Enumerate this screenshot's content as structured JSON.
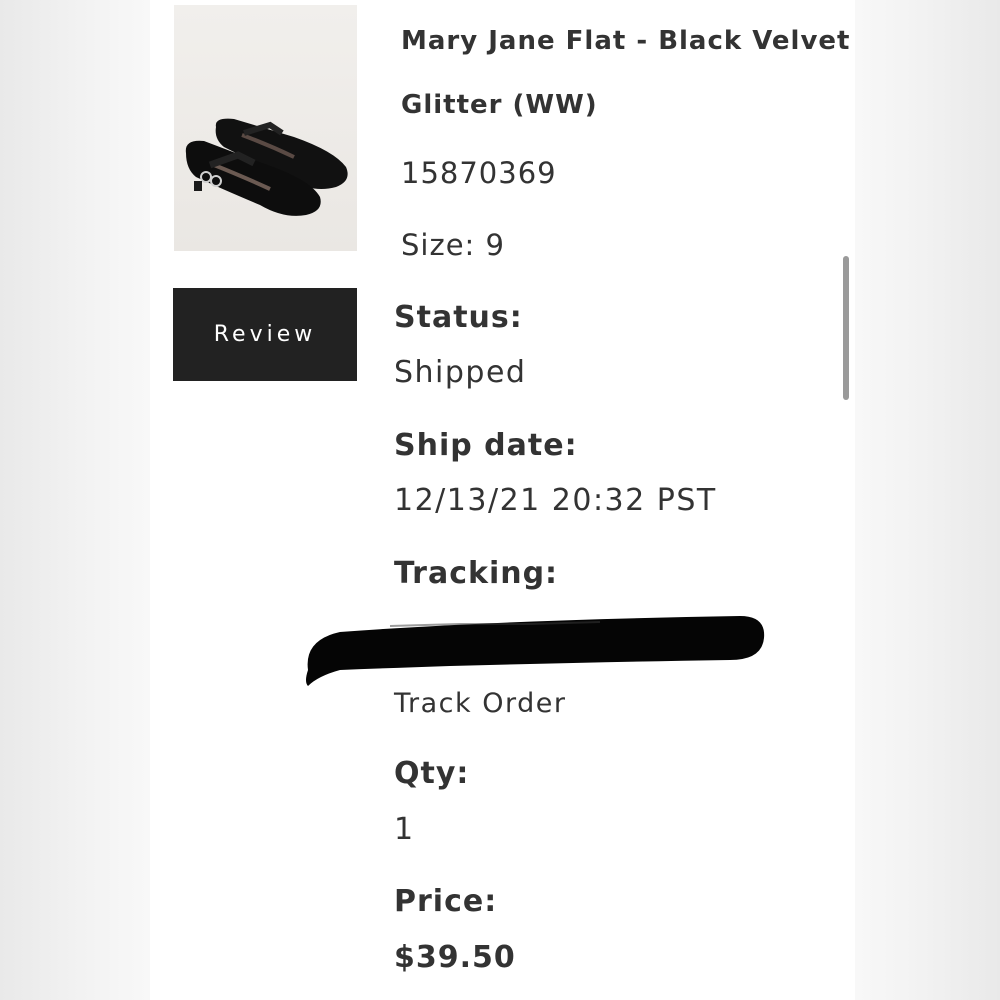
{
  "product": {
    "title_line1": "Mary Jane Flat - Black Velvet",
    "title_line2": "Glitter (WW)",
    "sku": "15870369",
    "size": "Size: 9",
    "image_alt": "black velvet mary jane flat shoes"
  },
  "review_button": {
    "label": "Review"
  },
  "status": {
    "label": "Status:",
    "value": "Shipped"
  },
  "ship_date": {
    "label": "Ship date:",
    "value": "12/13/21 20:32 PST"
  },
  "tracking": {
    "label": "Tracking:",
    "track_link": "Track Order"
  },
  "qty": {
    "label": "Qty:",
    "value": "1"
  },
  "price": {
    "label": "Price:",
    "value": "$39.50"
  },
  "colors": {
    "button_bg": "#222222",
    "text": "#333333",
    "panel_bg": "#ffffff"
  }
}
